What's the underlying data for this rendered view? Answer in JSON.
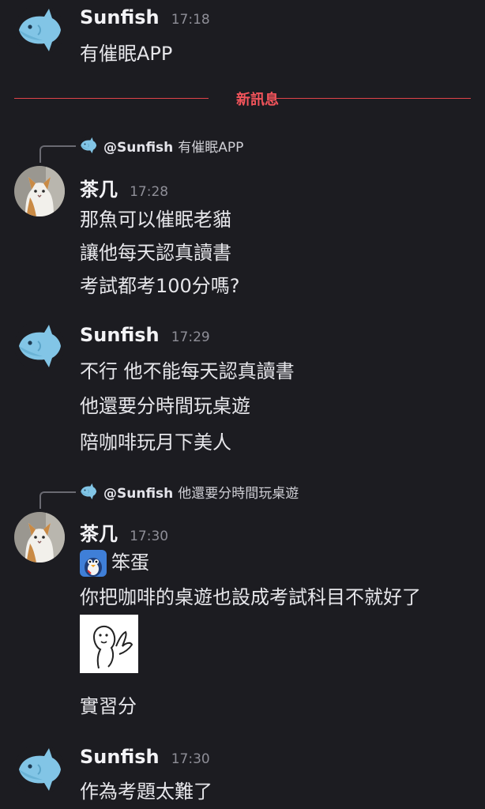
{
  "messages": {
    "m1": {
      "username": "Sunfish",
      "time": "17:18",
      "lines": [
        "有催眠APP"
      ]
    },
    "divider_label": "新訊息",
    "m2": {
      "reply": {
        "name": "@Sunfish",
        "text": "有催眠APP"
      },
      "username": "茶几",
      "time": "17:28",
      "lines": [
        "那魚可以催眠老貓",
        "讓他每天認真讀書",
        "考試都考100分嗎?"
      ]
    },
    "m3": {
      "username": "Sunfish",
      "time": "17:29",
      "lines": [
        "不行 他不能每天認真讀書",
        "他還要分時間玩桌遊",
        "陪咖啡玩月下美人"
      ]
    },
    "m4": {
      "reply": {
        "name": "@Sunfish",
        "text": "他還要分時間玩桌遊"
      },
      "username": "茶几",
      "time": "17:30",
      "lines": [
        "笨蛋",
        "你把咖啡的桌遊也設成考試科目不就好了",
        "實習分"
      ]
    },
    "m5": {
      "username": "Sunfish",
      "time": "17:30",
      "lines": [
        "作為考題太難了"
      ]
    }
  },
  "colors": {
    "background": "#1c1c21",
    "divider": "#e0444a",
    "sunfish_avatar": "#7cc4e4"
  },
  "icons": {
    "sunfish": "sunfish-avatar-icon",
    "cat": "cat-avatar-icon",
    "emoji": "penguin-emoji-icon",
    "sticker": "doodle-sticker-icon"
  }
}
